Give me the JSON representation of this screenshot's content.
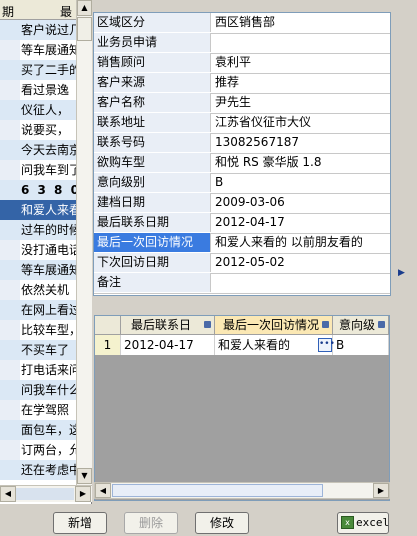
{
  "left_list": {
    "header": [
      "期",
      "最"
    ],
    "rows": [
      "客户说过几",
      "等车展通知",
      "买了二手的",
      "看过景逸",
      "仪征人，",
      "说要买，",
      "今天去南京",
      "问我车到了",
      "6 3 8 0",
      "和爱人来看",
      "过年的时候",
      "没打通电话",
      "等车展通知",
      "依然关机",
      "在网上看过",
      "比较车型，",
      "不买车了",
      "打电话来问",
      "问我车什么",
      "在学驾照",
      "面包车，这",
      "订两台，允",
      "还在考虑中"
    ]
  },
  "detail": {
    "fields": [
      {
        "label": "区域区分",
        "value": "西区销售部"
      },
      {
        "label": "业务员申请",
        "value": ""
      },
      {
        "label": "销售顾问",
        "value": "袁利平"
      },
      {
        "label": "客户来源",
        "value": "推荐"
      },
      {
        "label": "客户名称",
        "value": "尹先生"
      },
      {
        "label": "联系地址",
        "value": "江苏省仪征市大仪"
      },
      {
        "label": "联系号码",
        "value": "13082567187"
      },
      {
        "label": "欲购车型",
        "value": "和悦 RS 豪华版 1.8"
      },
      {
        "label": "意向级别",
        "value": "B"
      },
      {
        "label": "建档日期",
        "value": "2009-03-06"
      },
      {
        "label": "最后联系日期",
        "value": "2012-04-17"
      },
      {
        "label": "最后一次回访情况",
        "value": "和爱人来看的  以前朋友看的"
      },
      {
        "label": "下次回访日期",
        "value": "2012-05-02"
      },
      {
        "label": "备注",
        "value": ""
      }
    ]
  },
  "visit_grid": {
    "columns": [
      "最后联系日",
      "最后一次回访情况",
      "意向级"
    ],
    "rows": [
      {
        "num": "1",
        "date": "2012-04-17",
        "note": "和爱人来看的",
        "level": "B"
      }
    ]
  },
  "buttons": {
    "add": "新增",
    "delete": "删除",
    "edit": "修改",
    "excel": "excel"
  },
  "icons": {
    "lock": "lock-icon",
    "ellipsis": "ellipsis-icon",
    "excel": "excel-icon",
    "expand": "right-arrow-icon"
  },
  "colors": {
    "selection": "#3464a7",
    "highlight_label": "#3a7be0",
    "alt_row": "#dbe8f5"
  }
}
